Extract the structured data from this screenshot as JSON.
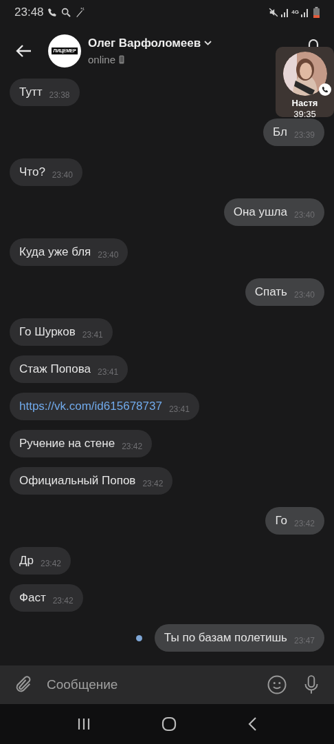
{
  "status_bar": {
    "time": "23:48",
    "network": "4G"
  },
  "header": {
    "name": "Олег Варфоломеев",
    "status": "online",
    "avatar_text": "ЛИЦЕМЕР"
  },
  "call_overlay": {
    "name": "Настя",
    "duration": "39:35"
  },
  "messages": [
    {
      "outgoing": false,
      "kind": "text",
      "text": "Тутт",
      "time": "23:38",
      "unread": false
    },
    {
      "outgoing": true,
      "kind": "text",
      "text": "Бл",
      "time": "23:39",
      "unread": false
    },
    {
      "outgoing": false,
      "kind": "text",
      "text": "Что?",
      "time": "23:40",
      "unread": false
    },
    {
      "outgoing": true,
      "kind": "text",
      "text": "Она ушла",
      "time": "23:40",
      "unread": false
    },
    {
      "outgoing": false,
      "kind": "text",
      "text": "Куда уже бля",
      "time": "23:40",
      "unread": false
    },
    {
      "outgoing": true,
      "kind": "text",
      "text": "Спать",
      "time": "23:40",
      "unread": false
    },
    {
      "outgoing": false,
      "kind": "text",
      "text": "Го Шурков",
      "time": "23:41",
      "unread": false
    },
    {
      "outgoing": false,
      "kind": "text",
      "text": "Стаж Попова",
      "time": "23:41",
      "unread": false
    },
    {
      "outgoing": false,
      "kind": "link",
      "text": "https://vk.com/id615678737",
      "time": "23:41",
      "unread": false
    },
    {
      "outgoing": false,
      "kind": "text",
      "text": "Ручение на стене",
      "time": "23:42",
      "unread": false
    },
    {
      "outgoing": false,
      "kind": "text",
      "text": "Официальный Попов",
      "time": "23:42",
      "unread": false
    },
    {
      "outgoing": true,
      "kind": "text",
      "text": "Го",
      "time": "23:42",
      "unread": false
    },
    {
      "outgoing": false,
      "kind": "text",
      "text": "Др",
      "time": "23:42",
      "unread": false
    },
    {
      "outgoing": false,
      "kind": "text",
      "text": "Фаст",
      "time": "23:42",
      "unread": false
    },
    {
      "outgoing": true,
      "kind": "text",
      "text": "Ты по базам полетишь",
      "time": "23:47",
      "unread": true
    }
  ],
  "composer": {
    "placeholder": "Сообщение"
  }
}
